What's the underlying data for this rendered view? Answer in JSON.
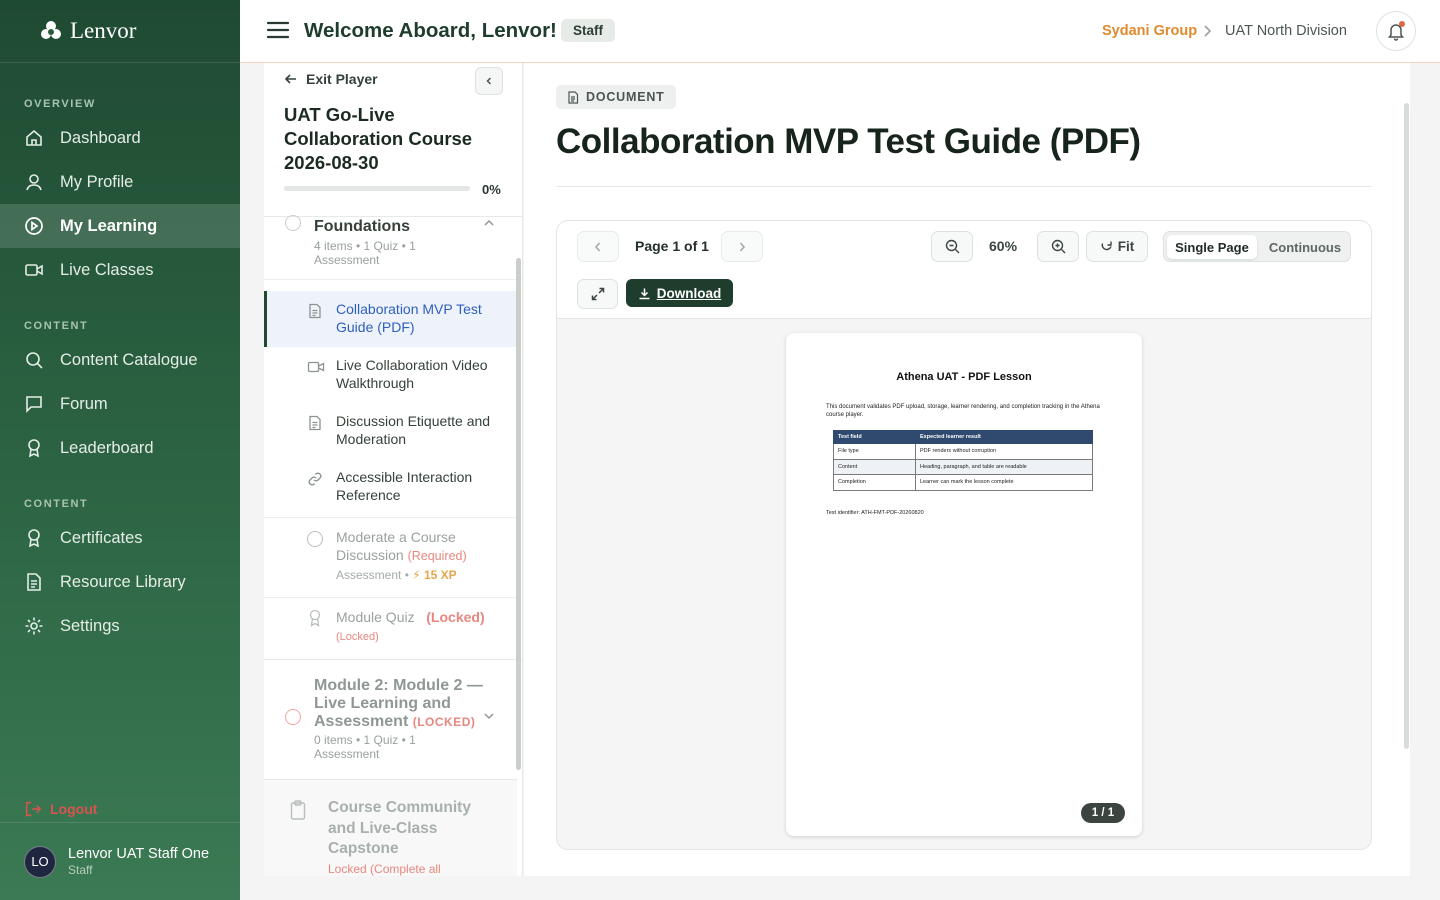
{
  "brand": {
    "name": "Lenvor"
  },
  "sidebar": {
    "sections": [
      "OVERVIEW",
      "CONTENT",
      "CONTENT"
    ],
    "items": [
      {
        "label": "Dashboard",
        "icon": "home-icon"
      },
      {
        "label": "My Profile",
        "icon": "user-icon"
      },
      {
        "label": "My Learning",
        "icon": "play-circle-icon",
        "active": true
      },
      {
        "label": "Live Classes",
        "icon": "video-icon"
      },
      {
        "label": "Content Catalogue",
        "icon": "search-icon"
      },
      {
        "label": "Forum",
        "icon": "chat-icon"
      },
      {
        "label": "Leaderboard",
        "icon": "award-icon"
      },
      {
        "label": "Certificates",
        "icon": "award-icon"
      },
      {
        "label": "Resource Library",
        "icon": "document-icon"
      },
      {
        "label": "Settings",
        "icon": "gear-icon"
      }
    ],
    "logout": "Logout",
    "user": {
      "initials": "LO",
      "name": "Lenvor UAT Staff One",
      "role": "Staff"
    }
  },
  "header": {
    "welcome": "Welcome Aboard, Lenvor!",
    "role_badge": "Staff",
    "breadcrumb": [
      "Sydani Group",
      "UAT North Division"
    ]
  },
  "course": {
    "exit_label": "Exit Player",
    "title": "UAT Go-Live Collaboration Course 2026-08-30",
    "progress_text": "0%",
    "progress": 0,
    "modules": [
      {
        "title": "Foundations",
        "meta": "4 items • 1 Quiz • 1 Assessment"
      },
      {
        "title": "Module 2: Module 2 — Live Learning and Assessment",
        "locked_tag": "(LOCKED)",
        "meta": "0 items • 1 Quiz • 1 Assessment"
      }
    ],
    "items": [
      {
        "label": "Collaboration MVP Test Guide (PDF)",
        "icon": "document-icon",
        "active": true
      },
      {
        "label": "Live Collaboration Video Walkthrough",
        "icon": "video-icon"
      },
      {
        "label": "Discussion Etiquette and Moderation",
        "icon": "document-icon"
      },
      {
        "label": "Accessible Interaction Reference",
        "icon": "link-icon"
      },
      {
        "label": "Moderate a Course Discussion",
        "required": "(Required)",
        "meta": "Assessment",
        "xp": "⚡ 15 XP",
        "icon": "circle-icon"
      },
      {
        "label": "Module Quiz",
        "locked": "(Locked)",
        "sublocked": "(Locked)",
        "icon": "award-icon"
      }
    ],
    "capstone": {
      "title": "Course Community and Live-Class Capstone",
      "note": "Locked (Complete all"
    }
  },
  "document": {
    "tag": "DOCUMENT",
    "title": "Collaboration MVP Test Guide (PDF)"
  },
  "viewer": {
    "page_label": "Page 1 of 1",
    "zoom": "60%",
    "fit_label": "Fit",
    "mode_single": "Single Page",
    "mode_continuous": "Continuous",
    "download_label": "Download",
    "page_badge": "1 / 1"
  },
  "pdf": {
    "title": "Athena UAT - PDF Lesson",
    "body": "This document validates PDF upload, storage, learner rendering, and completion tracking in the Athena course player.",
    "headers": [
      "Test field",
      "Expected learner result"
    ],
    "rows": [
      [
        "File type",
        "PDF renders without corruption"
      ],
      [
        "Content",
        "Heading, paragraph, and table are readable"
      ],
      [
        "Completion",
        "Learner can mark the lesson complete"
      ]
    ],
    "identifier": "Test identifier: ATH-FMT-PDF-20260820"
  },
  "colors": {
    "sidebar": "#1f4a32",
    "accent": "#e08a2e",
    "active_link": "#2f5fbd",
    "download": "#1f3d2c"
  }
}
